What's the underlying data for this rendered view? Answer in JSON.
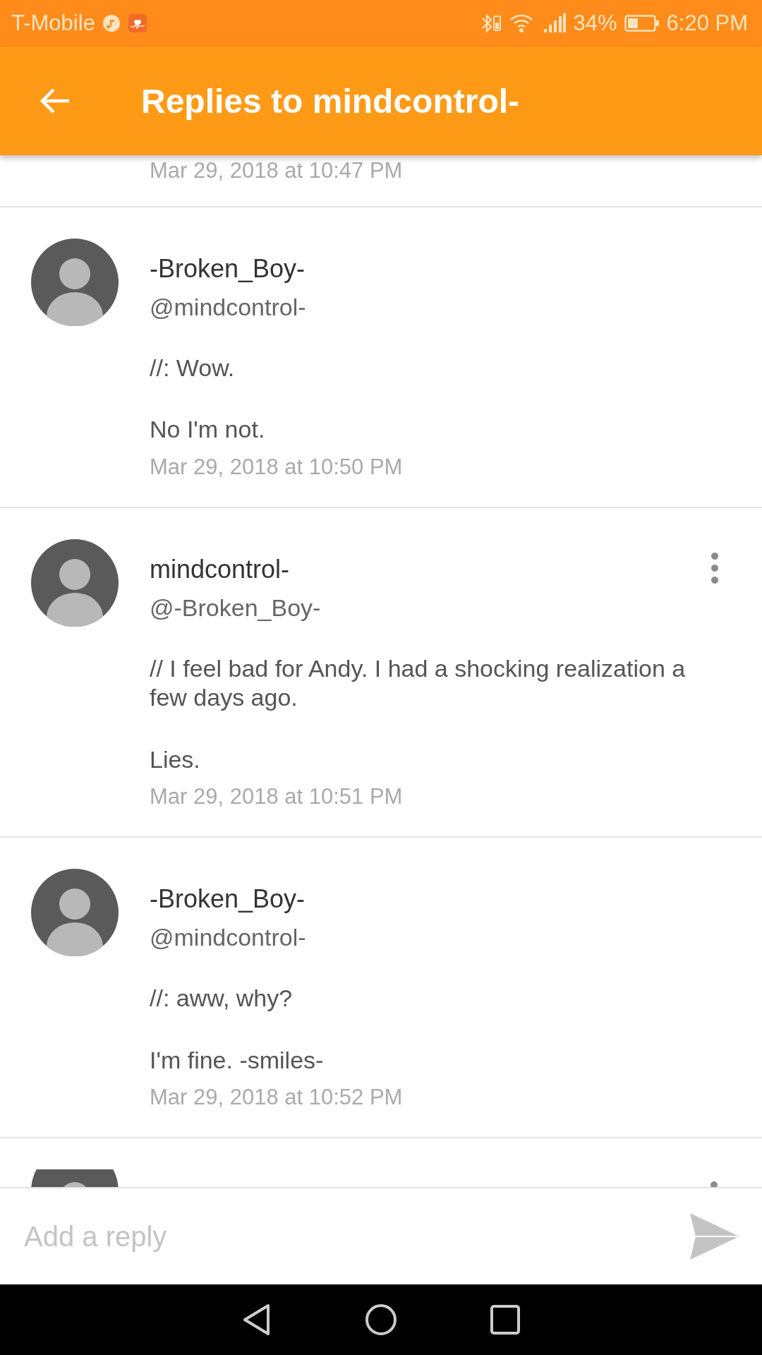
{
  "status_bar": {
    "carrier": "T-Mobile",
    "battery_percent": "34%",
    "time": "6:20 PM"
  },
  "header": {
    "title": "Replies to mindcontrol-"
  },
  "partial_top": {
    "date": "Mar 29, 2018 at 10:47 PM"
  },
  "replies": [
    {
      "author": "-Broken_Boy-",
      "handle": "@mindcontrol-",
      "paragraphs": [
        "//: Wow.",
        "No I'm not."
      ],
      "date": "Mar 29, 2018 at 10:50 PM",
      "has_menu": false
    },
    {
      "author": "mindcontrol-",
      "handle": "@-Broken_Boy-",
      "paragraphs": [
        "// I feel bad for Andy. I had a shocking realization a few days ago.",
        "Lies."
      ],
      "date": "Mar 29, 2018 at 10:51 PM",
      "has_menu": true
    },
    {
      "author": "-Broken_Boy-",
      "handle": "@mindcontrol-",
      "paragraphs": [
        "//: aww, why?",
        "I'm fine. -smiles-"
      ],
      "date": "Mar 29, 2018 at 10:52 PM",
      "has_menu": false
    }
  ],
  "partial_bottom": {
    "has_menu": true
  },
  "reply_bar": {
    "placeholder": "Add a reply"
  }
}
